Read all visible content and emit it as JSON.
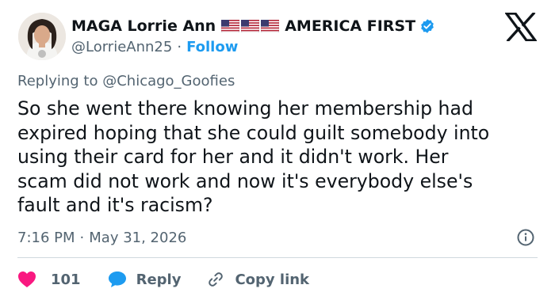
{
  "author": {
    "display_name": "MAGA Lorrie Ann",
    "flags": [
      "us-flag-icon",
      "us-flag-icon",
      "us-flag-icon"
    ],
    "tagline": "AMERICA FIRST",
    "handle": "@LorrieAnn25",
    "separator": "·",
    "follow_label": "Follow",
    "verified": true
  },
  "reply_context": {
    "prefix": "Replying to",
    "mention": "@Chicago_Goofies"
  },
  "tweet": {
    "text": "So she went there knowing her membership had\nexpired hoping that she could guilt somebody into\nusing their card for her and it didn't work. Her\nscam did not work and now it's everybody else's\nfault and it's racism?"
  },
  "meta": {
    "time": "7:16 PM",
    "separator": "·",
    "date": "May 31, 2026"
  },
  "actions": {
    "like_count": "101",
    "reply_label": "Reply",
    "copy_label": "Copy link"
  },
  "colors": {
    "accent": "#1d9bf0",
    "like": "#f91880",
    "text": "#0f1419",
    "muted": "#536471",
    "divider": "#cfd9de"
  }
}
